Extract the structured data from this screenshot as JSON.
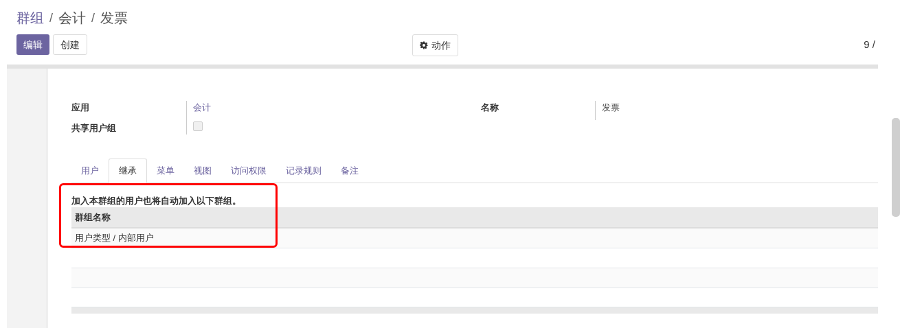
{
  "breadcrumb": [
    "群组",
    "会计",
    "发票"
  ],
  "breadcrumb_separator": "/",
  "buttons": {
    "edit": "编辑",
    "create": "创建",
    "action": "动作"
  },
  "pager": "9 /",
  "fields": {
    "application": {
      "label": "应用",
      "value": "会计"
    },
    "share": {
      "label": "共享用户组",
      "checked": false
    },
    "name": {
      "label": "名称",
      "value": "发票"
    }
  },
  "tabs": [
    {
      "label": "用户",
      "selected": false
    },
    {
      "label": "继承",
      "selected": true
    },
    {
      "label": "菜单",
      "selected": false
    },
    {
      "label": "视图",
      "selected": false
    },
    {
      "label": "访问权限",
      "selected": false
    },
    {
      "label": "记录规则",
      "selected": false
    },
    {
      "label": "备注",
      "selected": false
    }
  ],
  "description": "加入本群组的用户也将自动加入以下群组。",
  "table": {
    "columns": [
      "群组名称"
    ],
    "rows": [
      [
        "用户类型 / 内部用户"
      ]
    ]
  }
}
